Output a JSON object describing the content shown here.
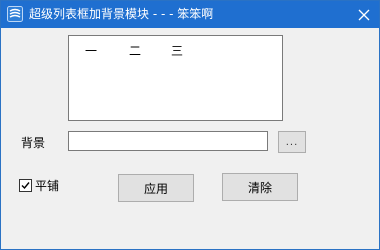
{
  "window": {
    "title": "超级列表框加背景模块 - - - 笨笨啊",
    "icon": "app-icon",
    "close_icon": "close-icon",
    "title_bar_color": "#1f6fd0"
  },
  "list": {
    "items": [
      "一",
      "二",
      "三"
    ]
  },
  "background": {
    "label": "背景",
    "path_value": "",
    "browse_label": "..."
  },
  "tile": {
    "label": "平铺",
    "checked": true
  },
  "buttons": {
    "apply_label": "应用",
    "clear_label": "清除"
  }
}
